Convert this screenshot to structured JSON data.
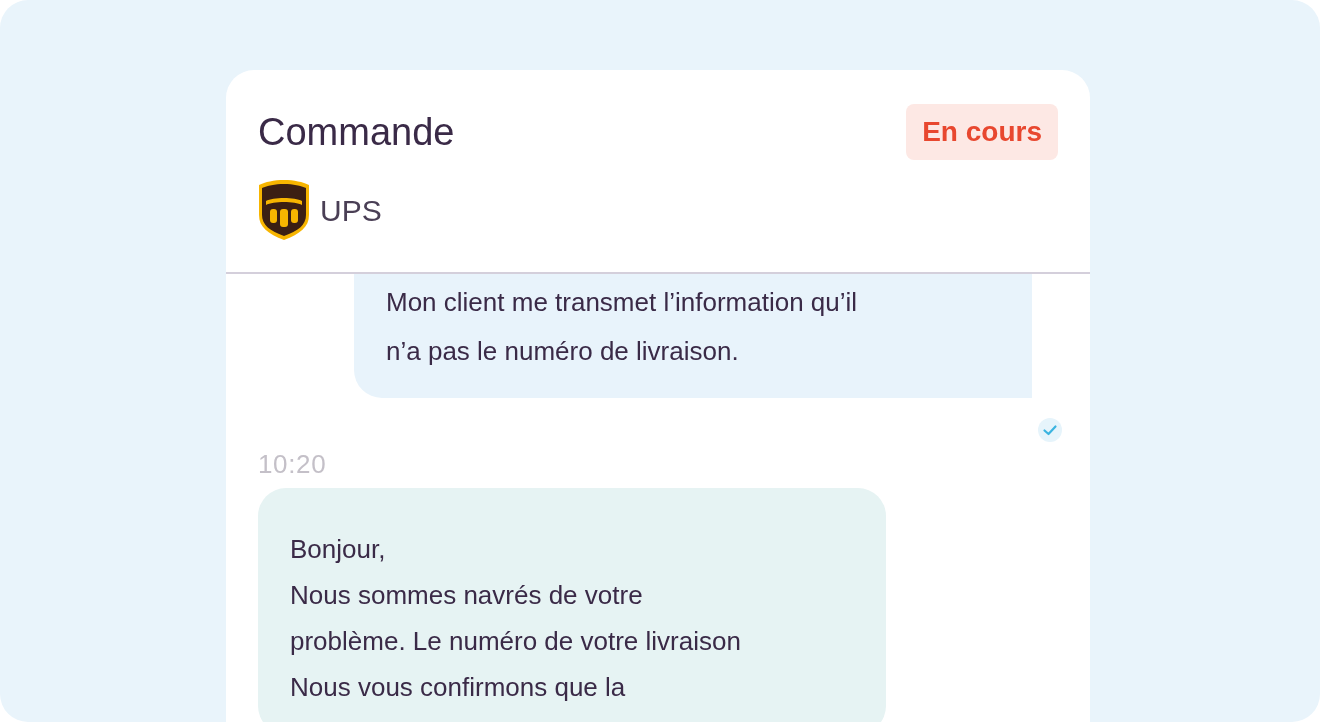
{
  "header": {
    "title": "Commande",
    "status": "En cours",
    "carrier": "UPS"
  },
  "messages": [
    {
      "kind": "outgoing",
      "text": "Mon client me transmet l’information qu’il\nn’a pas le numéro de livraison.",
      "read": true
    },
    {
      "kind": "incoming",
      "time": "10:20",
      "text": "Bonjour,\nNous sommes navrés de votre\nproblème. Le numéro de votre livraison\nNous vous confirmons que la"
    }
  ]
}
